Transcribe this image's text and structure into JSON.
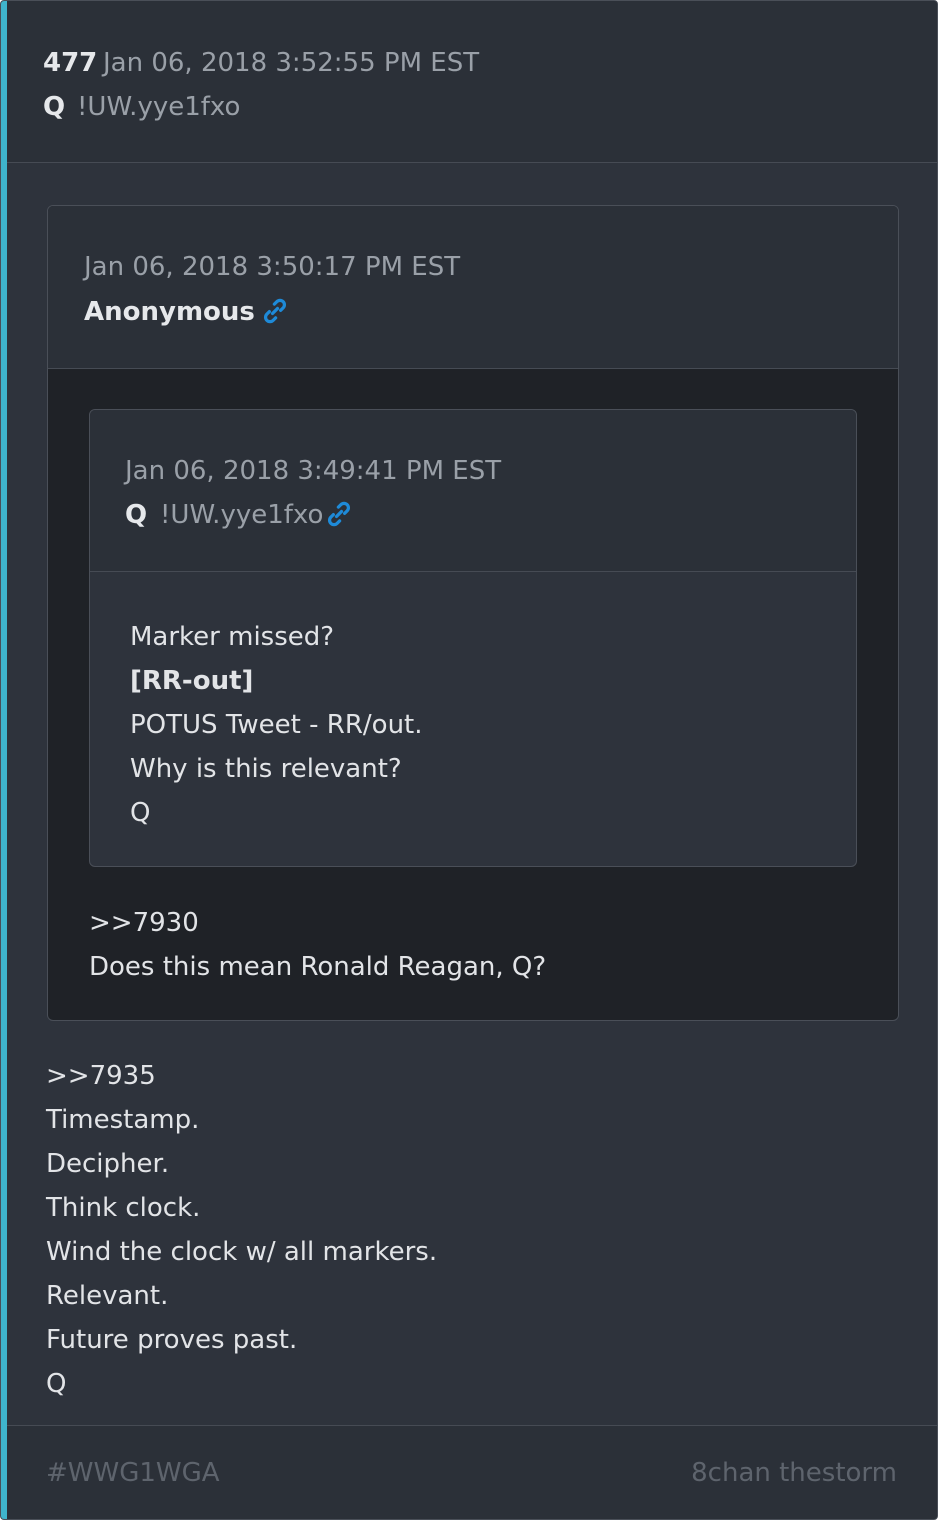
{
  "post": {
    "number": "477",
    "timestamp": "Jan 06, 2018 3:52:55 PM EST",
    "author": "Q",
    "tripcode": "!UW.yye1fxo",
    "body": [
      "Timestamp.",
      "Decipher.",
      "Think clock.",
      "Wind the clock w/ all markers.",
      "Relevant.",
      "Future proves past.",
      "Q"
    ],
    "reply_ref": ">>7935"
  },
  "quoted_post": {
    "timestamp": "Jan 06, 2018 3:50:17 PM EST",
    "author": "Anonymous",
    "link_icon": "link-icon",
    "reply_ref": ">>7930",
    "body": [
      "Does this mean Ronald Reagan, Q?"
    ]
  },
  "nested_quoted_post": {
    "timestamp": "Jan 06, 2018 3:49:41 PM EST",
    "author": "Q",
    "tripcode": "!UW.yye1fxo",
    "link_icon": "link-icon",
    "body": [
      "Marker missed?",
      "[RR-out]",
      "POTUS Tweet - RR/out.",
      "Why is this relevant?",
      "Q"
    ]
  },
  "footer": {
    "hashtag": "#WWG1WGA",
    "source": "8chan thestorm"
  },
  "colors": {
    "accent": "#3fb4cc",
    "link": "#1e8ad8"
  }
}
